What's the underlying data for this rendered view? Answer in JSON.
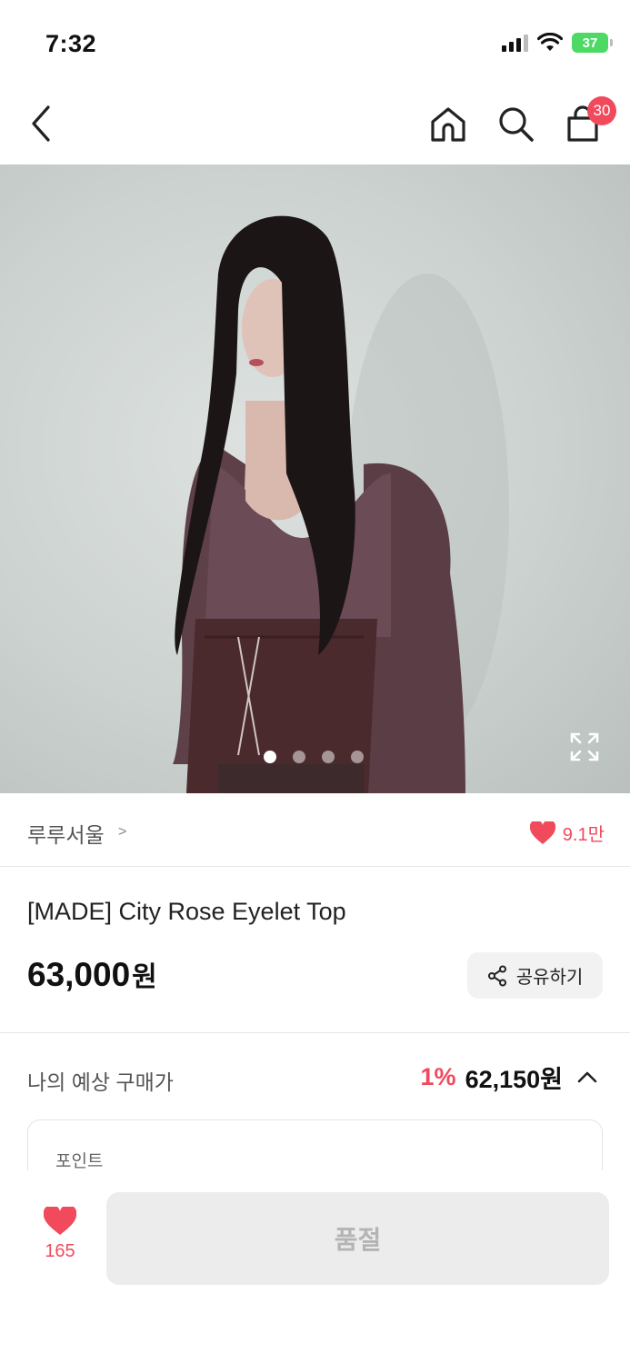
{
  "status_bar": {
    "time": "7:32",
    "battery": "37"
  },
  "nav": {
    "back_icon": "chevron-left-icon",
    "home_icon": "home-icon",
    "search_icon": "search-icon",
    "cart_icon": "shopping-bag-icon",
    "cart_badge": "30"
  },
  "product_image": {
    "carousel_total": 4,
    "carousel_active": 1,
    "expand_icon": "expand-icon"
  },
  "brand": {
    "name": "루루서울",
    "chevron": ">",
    "like_count": "9.1만"
  },
  "product": {
    "title": "[MADE] City Rose Eyelet Top",
    "price": "63,000",
    "price_unit": "원"
  },
  "share": {
    "label": "공유하기"
  },
  "estimated": {
    "label": "나의 예상 구매가",
    "rate": "1%",
    "price": "62,150원"
  },
  "points": {
    "label": "포인트"
  },
  "bottom_bar": {
    "wish_count": "165",
    "buy_label": "품절"
  },
  "colors": {
    "accent": "#f04a5c",
    "soldout_bg": "#ececec",
    "soldout_text": "#b4b4b4"
  }
}
